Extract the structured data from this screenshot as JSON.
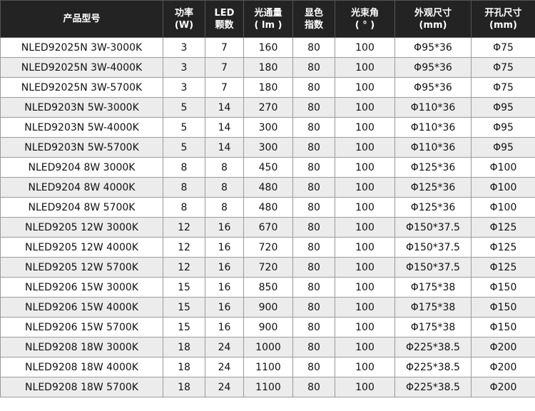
{
  "table": {
    "headers": [
      {
        "line1": "产品型号",
        "line2": ""
      },
      {
        "line1": "功率",
        "line2": "(W)"
      },
      {
        "line1": "LED",
        "line2": "颗数"
      },
      {
        "line1": "光通量",
        "line2": "( lm )"
      },
      {
        "line1": "显色",
        "line2": "指数"
      },
      {
        "line1": "光束角",
        "line2": "( ° )"
      },
      {
        "line1": "外观尺寸",
        "line2": "(mm)"
      },
      {
        "line1": "开孔尺寸",
        "line2": "(mm)"
      }
    ],
    "rows": [
      [
        "NLED92025N 3W-3000K",
        "3",
        "7",
        "160",
        "80",
        "100",
        "Φ95*36",
        "Φ75"
      ],
      [
        "NLED92025N 3W-4000K",
        "3",
        "7",
        "180",
        "80",
        "100",
        "Φ95*36",
        "Φ75"
      ],
      [
        "NLED92025N 3W-5700K",
        "3",
        "7",
        "180",
        "80",
        "100",
        "Φ95*36",
        "Φ75"
      ],
      [
        "NLED9203N 5W-3000K",
        "5",
        "14",
        "270",
        "80",
        "100",
        "Φ110*36",
        "Φ95"
      ],
      [
        "NLED9203N 5W-4000K",
        "5",
        "14",
        "300",
        "80",
        "100",
        "Φ110*36",
        "Φ95"
      ],
      [
        "NLED9203N 5W-5700K",
        "5",
        "14",
        "300",
        "80",
        "100",
        "Φ110*36",
        "Φ95"
      ],
      [
        "NLED9204 8W 3000K",
        "8",
        "8",
        "450",
        "80",
        "100",
        "Φ125*36",
        "Φ100"
      ],
      [
        "NLED9204 8W 4000K",
        "8",
        "8",
        "480",
        "80",
        "100",
        "Φ125*36",
        "Φ100"
      ],
      [
        "NLED9204 8W 5700K",
        "8",
        "8",
        "480",
        "80",
        "100",
        "Φ125*36",
        "Φ100"
      ],
      [
        "NLED9205 12W 3000K",
        "12",
        "16",
        "670",
        "80",
        "100",
        "Φ150*37.5",
        "Φ125"
      ],
      [
        "NLED9205 12W 4000K",
        "12",
        "16",
        "720",
        "80",
        "100",
        "Φ150*37.5",
        "Φ125"
      ],
      [
        "NLED9205 12W 5700K",
        "12",
        "16",
        "720",
        "80",
        "100",
        "Φ150*37.5",
        "Φ125"
      ],
      [
        "NLED9206 15W 3000K",
        "15",
        "16",
        "850",
        "80",
        "100",
        "Φ175*38",
        "Φ150"
      ],
      [
        "NLED9206 15W 4000K",
        "15",
        "16",
        "900",
        "80",
        "100",
        "Φ175*38",
        "Φ150"
      ],
      [
        "NLED9206 15W 5700K",
        "15",
        "16",
        "900",
        "80",
        "100",
        "Φ175*38",
        "Φ150"
      ],
      [
        "NLED9208 18W 3000K",
        "18",
        "24",
        "1000",
        "80",
        "100",
        "Φ225*38.5",
        "Φ200"
      ],
      [
        "NLED9208 18W 4000K",
        "18",
        "24",
        "1100",
        "80",
        "100",
        "Φ225*38.5",
        "Φ200"
      ],
      [
        "NLED9208 18W 5700K",
        "18",
        "24",
        "1100",
        "80",
        "100",
        "Φ225*38.5",
        "Φ200"
      ]
    ]
  },
  "colors": {
    "header_background": "#232323",
    "header_text": "#ffffff",
    "row_odd": "#ffffff",
    "row_even": "#ececec",
    "border": "#9a9a9a"
  }
}
